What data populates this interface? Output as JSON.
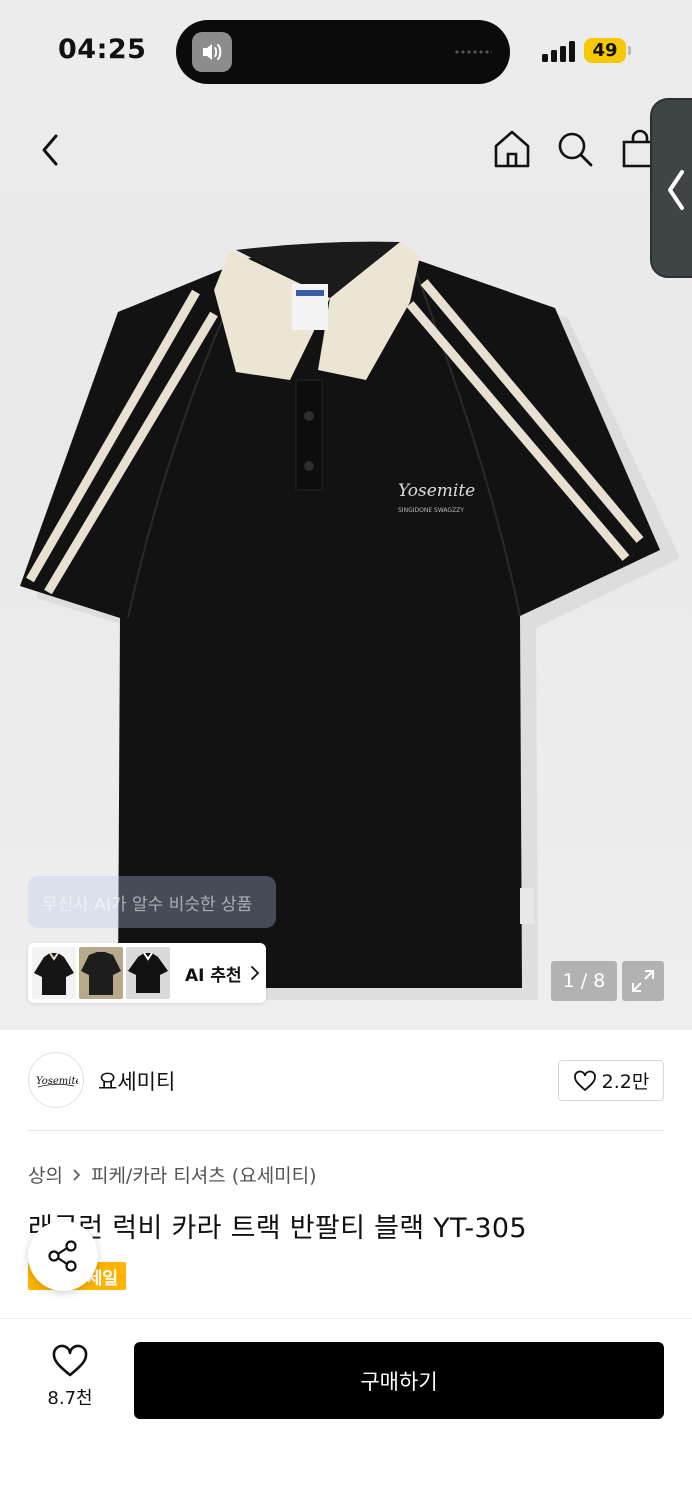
{
  "status_bar": {
    "time": "04:25",
    "battery": "49"
  },
  "nav": {
    "back_icon": "chevron-left-icon",
    "home_icon": "home-icon",
    "search_icon": "search-icon",
    "bag_icon": "shopping-bag-icon"
  },
  "gallery": {
    "ai_ghost_text": "무신사 AI가 알수 비슷한 상품",
    "ai_recommend_label": "AI 추천",
    "pager": "1 / 8",
    "expand_icon": "expand-icon"
  },
  "brand": {
    "name": "요세미티",
    "logo_text": "Yosemite",
    "likes": "2.2만"
  },
  "breadcrumb": [
    "상의",
    "피케/카라 티셔츠 (요세미티)"
  ],
  "product": {
    "title": "래글런 럭비 카라 트랙 반팔티 블랙 YT-305",
    "badge": "세일"
  },
  "actions": {
    "wish_count": "8.7천",
    "buy_label": "구매하기",
    "share_icon": "share-icon"
  },
  "colors": {
    "accent_sale": "#ffb300",
    "buy_button": "#000000"
  }
}
